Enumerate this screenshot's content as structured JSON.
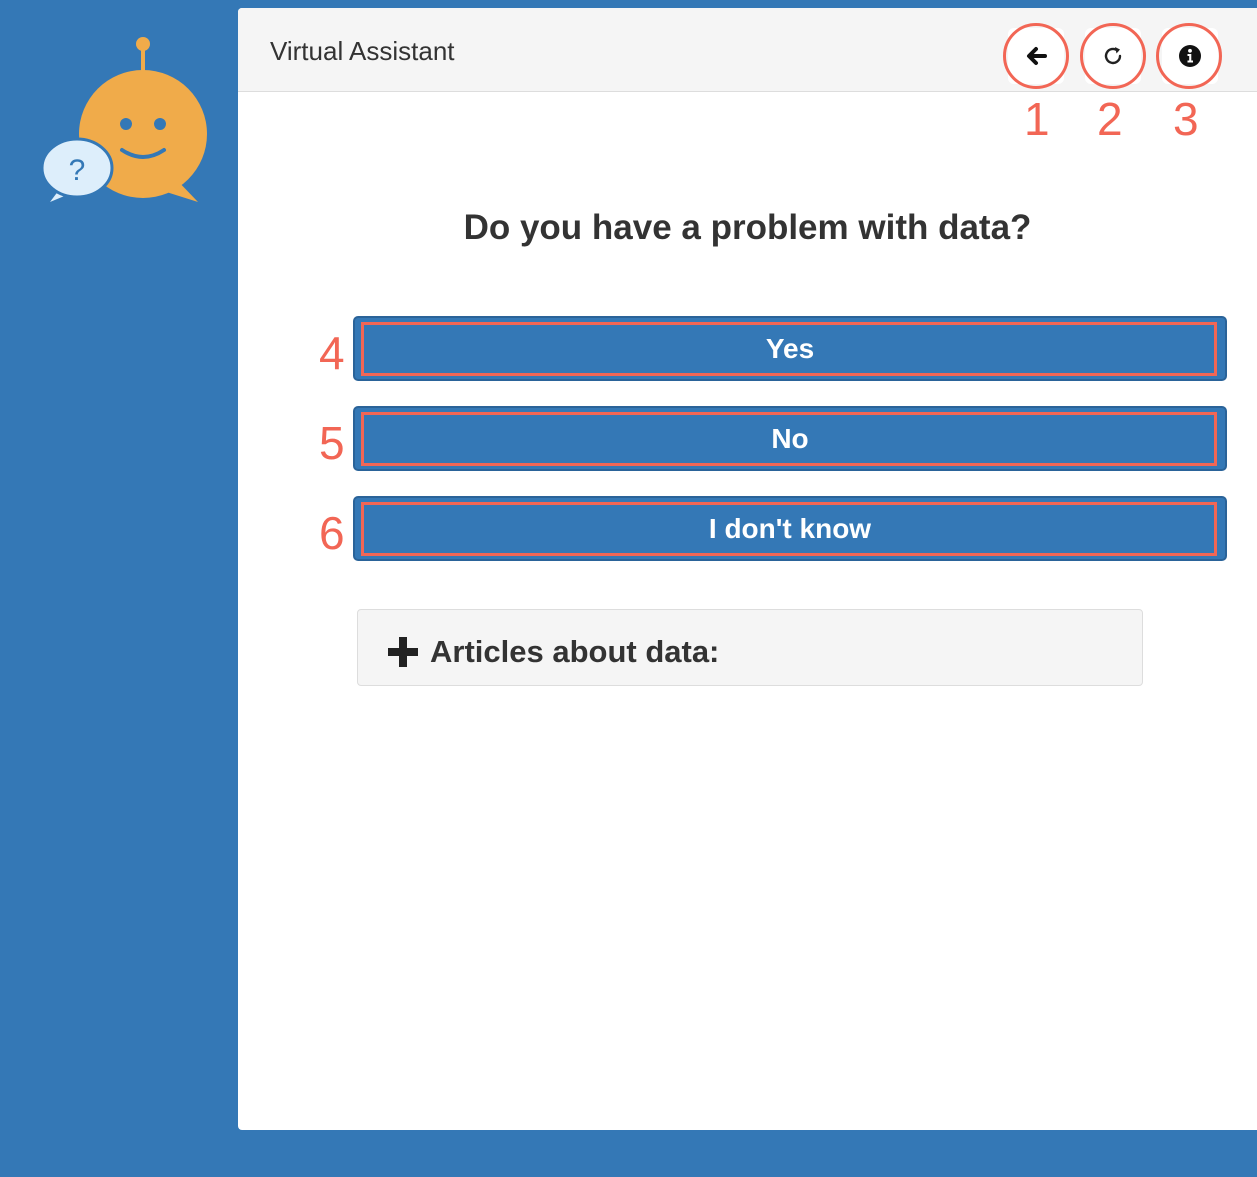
{
  "app": {
    "title": "Virtual Assistant",
    "logo_icon": "chatbot-logo-icon",
    "logo_glyph": "?"
  },
  "header": {
    "back": {
      "icon": "arrow-left-icon",
      "marker": "1"
    },
    "restart": {
      "icon": "refresh-icon",
      "marker": "2"
    },
    "info": {
      "icon": "info-icon",
      "marker": "3"
    }
  },
  "main": {
    "question": "Do you have a problem with data?",
    "answers": [
      {
        "label": "Yes",
        "marker": "4"
      },
      {
        "label": "No",
        "marker": "5"
      },
      {
        "label": "I don't know",
        "marker": "6"
      }
    ],
    "articles": {
      "label": "Articles about data:",
      "icon": "plus-icon"
    }
  },
  "colors": {
    "background": "#3478b6",
    "button": "#3478b6",
    "logo": "#f0ab4a",
    "annotation": "#f26655"
  }
}
